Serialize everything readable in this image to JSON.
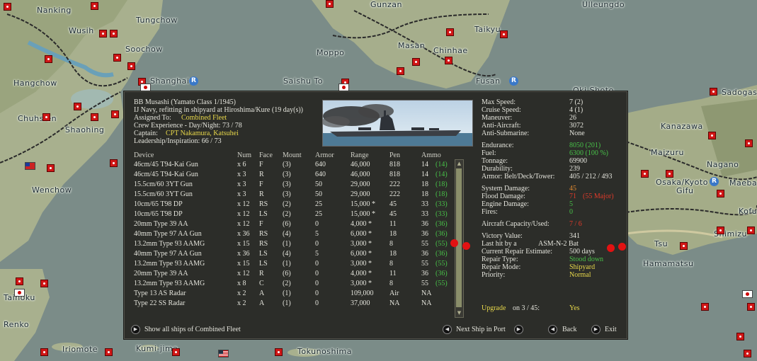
{
  "map": {
    "labels": [
      "Nanking",
      "Tungchow",
      "Wusih",
      "Soochow",
      "Shanghai",
      "Hangchow",
      "Chuhsien",
      "Shaohing",
      "Wenchow",
      "Taihoku",
      "Renko",
      "Iriomote",
      "Kumi-jima",
      "Tokunoshima",
      "Gunzan",
      "Taikyu",
      "Masan",
      "Chinhae",
      "Moppo",
      "Saishu To",
      "Fusan",
      "Ulleungdo",
      "Oki Shoto",
      "Sadogas",
      "Kanazawa",
      "Maizuru",
      "Nagano",
      "Osaka/Kyoto",
      "Gifu",
      "Maebas",
      "Kofu",
      "Shimizu",
      "Tsu",
      "Hamamatsu"
    ],
    "base_marker": "R"
  },
  "ship": {
    "name": "BB Musashi (Yamato Class 1/1945)",
    "status": "IJ Navy, refitting in shipyard at Hiroshima/Kure (19 day(s))",
    "assigned_label": "Assigned To:",
    "assigned_value": "Combined Fleet",
    "crew_exp": "Crew Experience - Day/Night: 73 / 78",
    "captain_label": "Captain:",
    "captain_value": "CPT Nakamura, Katsuhei",
    "leadership": "Leadership/Inspiration: 66 / 73"
  },
  "weapons": {
    "headers": [
      "Device",
      "Num",
      "Face",
      "Mount",
      "Armor",
      "Range",
      "Pen",
      "Ammo"
    ],
    "rows": [
      [
        "46cm/45 T94-Kai Gun",
        "x 6",
        "F",
        "(3)",
        "640",
        "46,000",
        "818",
        "14",
        "(14)"
      ],
      [
        "46cm/45 T94-Kai Gun",
        "x 3",
        "R",
        "(3)",
        "640",
        "46,000",
        "818",
        "14",
        "(14)"
      ],
      [
        "15.5cm/60 3YT Gun",
        "x 3",
        "F",
        "(3)",
        "50",
        "29,000",
        "222",
        "18",
        "(18)"
      ],
      [
        "15.5cm/60 3YT Gun",
        "x 3",
        "R",
        "(3)",
        "50",
        "29,000",
        "222",
        "18",
        "(18)"
      ],
      [
        "10cm/65 T98 DP",
        "x 12",
        "RS",
        "(2)",
        "25",
        "15,000 *",
        "45",
        "33",
        "(33)"
      ],
      [
        "10cm/65 T98 DP",
        "x 12",
        "LS",
        "(2)",
        "25",
        "15,000 *",
        "45",
        "33",
        "(33)"
      ],
      [
        "20mm Type 39 AA",
        "x 12",
        "F",
        "(6)",
        "0",
        "4,000 *",
        "11",
        "36",
        "(36)"
      ],
      [
        "40mm Type 97 AA Gun",
        "x 36",
        "RS",
        "(4)",
        "5",
        "6,000 *",
        "18",
        "36",
        "(36)"
      ],
      [
        "13.2mm Type 93 AAMG",
        "x 15",
        "RS",
        "(1)",
        "0",
        "3,000 *",
        "8",
        "55",
        "(55)"
      ],
      [
        "40mm Type 97 AA Gun",
        "x 36",
        "LS",
        "(4)",
        "5",
        "6,000 *",
        "18",
        "36",
        "(36)"
      ],
      [
        "13.2mm Type 93 AAMG",
        "x 15",
        "LS",
        "(1)",
        "0",
        "3,000 *",
        "8",
        "55",
        "(55)"
      ],
      [
        "20mm Type 39 AA",
        "x 12",
        "R",
        "(6)",
        "0",
        "4,000 *",
        "11",
        "36",
        "(36)"
      ],
      [
        "13.2mm Type 93 AAMG",
        "x 8",
        "C",
        "(2)",
        "0",
        "3,000 *",
        "8",
        "55",
        "(55)"
      ],
      [
        "Type 13 AS Radar",
        "x 2",
        "A",
        "(1)",
        "0",
        "109,000",
        "Air",
        "NA",
        ""
      ],
      [
        "Type 22 SS Radar",
        "x 2",
        "A",
        "(1)",
        "0",
        "37,000",
        "NA",
        "NA",
        ""
      ]
    ]
  },
  "stats": {
    "max_speed_label": "Max Speed:",
    "max_speed": "7 (2)",
    "cruise_label": "Cruise Speed:",
    "cruise": "4 (1)",
    "maneuver_label": "Maneuver:",
    "maneuver": "26",
    "aa_label": "Anti-Aircraft:",
    "aa": "3072",
    "asub_label": "Anti-Submarine:",
    "asub": "None",
    "endurance_label": "Endurance:",
    "endurance": "8050 (201)",
    "fuel_label": "Fuel:",
    "fuel": "6300 (100 %)",
    "tonnage_label": "Tonnage:",
    "tonnage": "69900",
    "durability_label": "Durability:",
    "durability": "239",
    "armor_label": "Armor: Belt/Deck/Tower:",
    "armor": "405 / 212 / 493",
    "sysdmg_label": "System Damage:",
    "sysdmg": "45",
    "flood_label": "Flood Damage:",
    "flood": "71",
    "flood_major": "(55 Major)",
    "engdmg_label": "Engine Damage:",
    "engdmg": "5",
    "fires_label": "Fires:",
    "fires": "0",
    "aircraft_label": "Aircraft Capacity/Used:",
    "aircraft": "7 / 6",
    "vp_label": "Victory Value:",
    "vp": "341",
    "lasthit_label": "Last hit by a",
    "lasthit": "ASM-N-2 Bat",
    "repair_est_label": "Current Repair Estimate:",
    "repair_est": "500 days",
    "repair_type_label": "Repair Type:",
    "repair_type": "Stood down",
    "repair_mode_label": "Repair Mode:",
    "repair_mode": "Shipyard",
    "priority_label": "Priority:",
    "priority": "Normal",
    "upgrade_label": "Upgrade",
    "upgrade_on": "on 3 / 45:",
    "upgrade_value": "Yes"
  },
  "buttons": {
    "show_all": "Show all ships of Combined Fleet",
    "next_ship": "Next Ship in Port",
    "back": "Back",
    "exit": "Exit"
  }
}
